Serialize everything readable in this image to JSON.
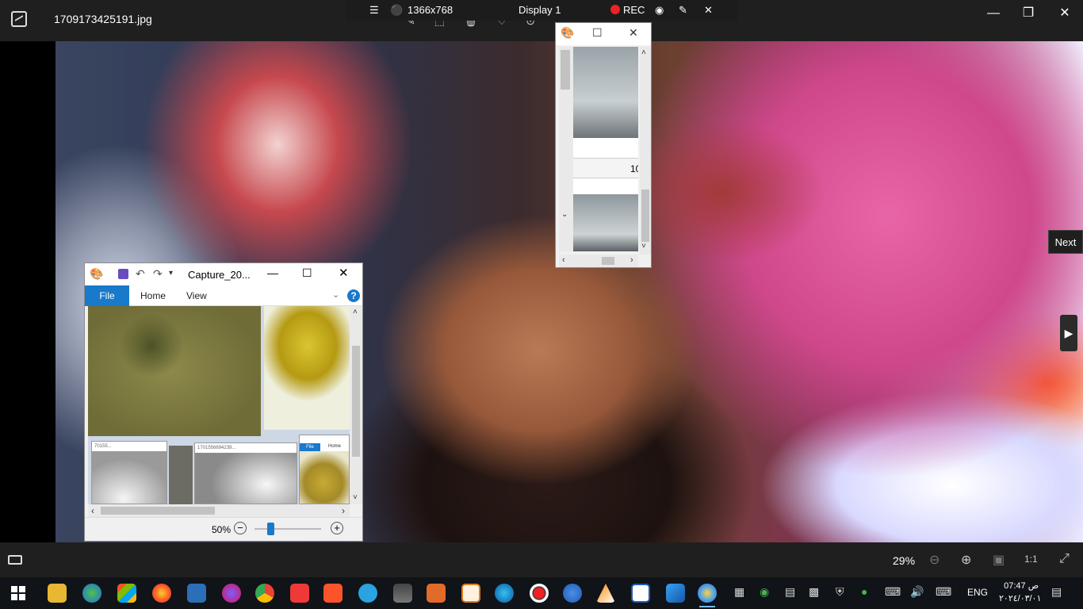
{
  "viewer": {
    "file_name": "1709173425191.jpg",
    "next_label": "Next",
    "zoom": "29%"
  },
  "display_bar": {
    "resolution": "1366x768",
    "display": "Display 1",
    "rec": "REC"
  },
  "paint_main": {
    "title": "Capture_20...",
    "tabs": [
      "File",
      "Home",
      "View"
    ],
    "help": "?",
    "zoom": "50%",
    "thumb_titles": [
      "70155...",
      "1701556694239..."
    ],
    "mini_tabs": [
      "File",
      "Home"
    ]
  },
  "paint_small": {
    "cell_value": "10"
  },
  "taskbar": {
    "lang": "ENG",
    "ampm": "ص",
    "time": "07:47",
    "date": "٢٠٢٤/٠٣/٠١"
  },
  "colors": {
    "accent": "#1979ca",
    "titlebar": "#1f1f1f",
    "taskbar": "#101318",
    "rec": "#ee2222"
  },
  "icons": {
    "taskbar_apps": [
      "file-explorer-icon",
      "globe-icon",
      "store-icon",
      "firefox-icon",
      "maxthon-icon",
      "opera-icon",
      "chrome-icon",
      "vivaldi-icon",
      "brave-icon",
      "telegram-icon",
      "calendar-icon",
      "office-icon",
      "presentation-icon",
      "edge-icon",
      "recorder-icon",
      "search-app-icon",
      "vlc-icon",
      "document-icon",
      "photos-icon",
      "paint-icon"
    ]
  }
}
